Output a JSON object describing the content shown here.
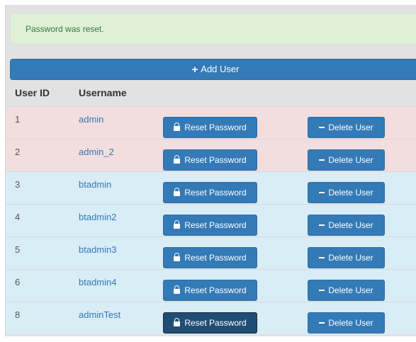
{
  "alert": {
    "message": "Password was reset."
  },
  "toolbar": {
    "add_user_label": "Add User",
    "add_user_icon": "plus-icon"
  },
  "table": {
    "headers": {
      "user_id": "User ID",
      "username": "Username"
    },
    "rows": [
      {
        "id": "1",
        "username": "admin",
        "reset_label": "Reset Password",
        "delete_label": "Delete User",
        "variant": "danger"
      },
      {
        "id": "2",
        "username": "admin_2",
        "reset_label": "Reset Password",
        "delete_label": "Delete User",
        "variant": "danger"
      },
      {
        "id": "3",
        "username": "btadmin",
        "reset_label": "Reset Password",
        "delete_label": "Delete User",
        "variant": "info"
      },
      {
        "id": "4",
        "username": "btadmin2",
        "reset_label": "Reset Password",
        "delete_label": "Delete User",
        "variant": "info"
      },
      {
        "id": "5",
        "username": "btadmin3",
        "reset_label": "Reset Password",
        "delete_label": "Delete User",
        "variant": "info"
      },
      {
        "id": "6",
        "username": "btadmin4",
        "reset_label": "Reset Password",
        "delete_label": "Delete User",
        "variant": "info"
      },
      {
        "id": "8",
        "username": "adminTest",
        "reset_label": "Reset Password",
        "delete_label": "Delete User",
        "variant": "info"
      }
    ]
  },
  "colors": {
    "primary": "#337ab7",
    "primary_active": "#204d74",
    "success_bg": "#dff0d8",
    "success_text": "#3c763d",
    "danger_row": "#f2dede",
    "info_row": "#d9edf7"
  },
  "icons": {
    "reset": "lock-icon",
    "delete": "minus-icon"
  }
}
